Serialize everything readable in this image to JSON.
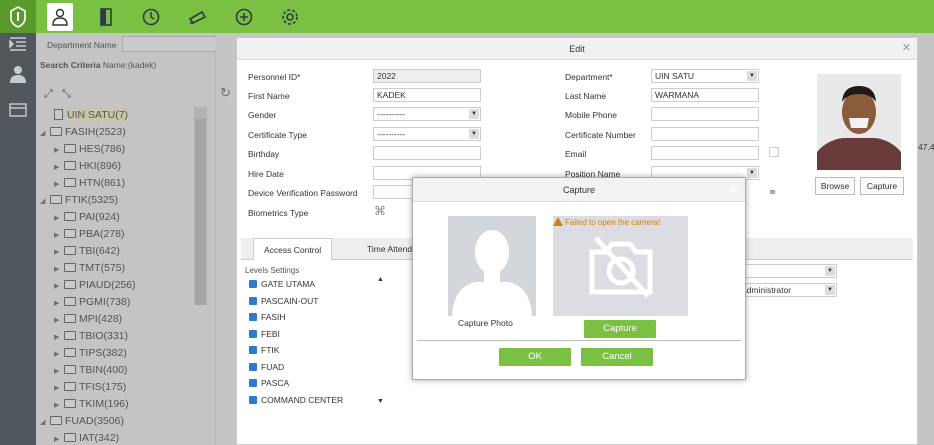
{
  "topbar": {
    "icons": [
      "personnel-icon",
      "door-icon",
      "clock-icon",
      "camera-icon",
      "shield-plus-icon",
      "gear-icon"
    ]
  },
  "sidebar": {
    "department_label": "Department Name",
    "department_value": "",
    "criteria_label": "Search Criteria",
    "criteria_value": "Name:(kadek)"
  },
  "tree": [
    {
      "label": "UIN SATU(7)",
      "level": 0,
      "type": "root"
    },
    {
      "label": "FASIH(2523)",
      "level": 0,
      "type": "open"
    },
    {
      "label": "HES(786)",
      "level": 1,
      "type": "closed"
    },
    {
      "label": "HKI(896)",
      "level": 1,
      "type": "closed"
    },
    {
      "label": "HTN(861)",
      "level": 1,
      "type": "closed"
    },
    {
      "label": "FTIK(5325)",
      "level": 0,
      "type": "open"
    },
    {
      "label": "PAI(924)",
      "level": 1,
      "type": "closed"
    },
    {
      "label": "PBA(278)",
      "level": 1,
      "type": "closed"
    },
    {
      "label": "TBI(642)",
      "level": 1,
      "type": "closed"
    },
    {
      "label": "TMT(575)",
      "level": 1,
      "type": "closed"
    },
    {
      "label": "PIAUD(256)",
      "level": 1,
      "type": "closed"
    },
    {
      "label": "PGMI(738)",
      "level": 1,
      "type": "closed"
    },
    {
      "label": "MPI(428)",
      "level": 1,
      "type": "closed"
    },
    {
      "label": "TBIO(331)",
      "level": 1,
      "type": "closed"
    },
    {
      "label": "TIPS(382)",
      "level": 1,
      "type": "closed"
    },
    {
      "label": "TBIN(400)",
      "level": 1,
      "type": "closed"
    },
    {
      "label": "TFIS(175)",
      "level": 1,
      "type": "closed"
    },
    {
      "label": "TKIM(196)",
      "level": 1,
      "type": "closed"
    },
    {
      "label": "FUAD(3506)",
      "level": 0,
      "type": "open"
    },
    {
      "label": "IAT(342)",
      "level": 1,
      "type": "closed"
    }
  ],
  "edit": {
    "title": "Edit",
    "personnel_id_label": "Personnel ID*",
    "personnel_id": "2022",
    "first_name_label": "First Name",
    "first_name": "KADEK",
    "gender_label": "Gender",
    "gender": "----------",
    "cert_type_label": "Certificate Type",
    "cert_type": "----------",
    "birthday_label": "Birthday",
    "hire_date_label": "Hire Date",
    "dev_pwd_label": "Device Verification Password",
    "bio_label": "Biometrics Type",
    "department_label": "Department*",
    "department": "UIN SATU",
    "last_name_label": "Last Name",
    "last_name": "WARMANA",
    "mobile_label": "Mobile Phone",
    "cert_no_label": "Certificate Number",
    "email_label": "Email",
    "position_label": "Position Name",
    "browse": "Browse",
    "capture": "Capture",
    "tab_access": "Access Control",
    "tab_time": "Time Attenda",
    "levels_label": "Levels Settings",
    "levels": [
      "GATE UTAMA",
      "PASCAIN-OUT",
      "FASIH",
      "FEBI",
      "FTIK",
      "FUAD",
      "PASCA",
      "COMMAND CENTER"
    ],
    "right_partial": "47.4",
    "admin_partial": "Administrator"
  },
  "capture": {
    "title": "Capture",
    "error": "Failed to open the camera!",
    "photo_label": "Capture Photo",
    "capture_btn": "Capture",
    "ok": "OK",
    "cancel": "Cancel"
  }
}
